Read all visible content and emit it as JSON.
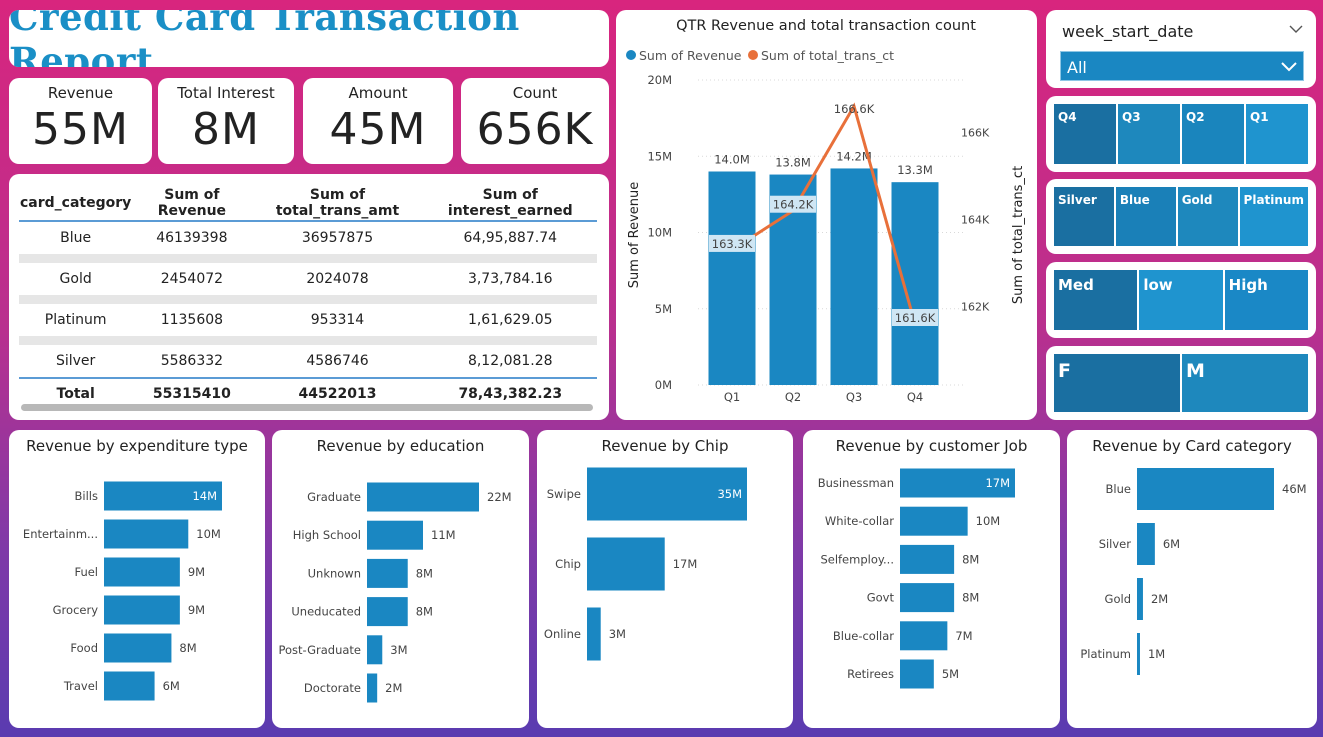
{
  "title": "Credit Card Transaction Report",
  "kpis": [
    {
      "label": "Revenue",
      "value": "55M"
    },
    {
      "label": "Total Interest",
      "value": "8M"
    },
    {
      "label": "Amount",
      "value": "45M"
    },
    {
      "label": "Count",
      "value": "656K"
    }
  ],
  "table": {
    "headers": [
      "card_category",
      "Sum of Revenue",
      "Sum of total_trans_amt",
      "Sum of interest_earned"
    ],
    "rows": [
      [
        "Blue",
        "46139398",
        "36957875",
        "64,95,887.74"
      ],
      [
        "Gold",
        "2454072",
        "2024078",
        "3,73,784.16"
      ],
      [
        "Platinum",
        "1135608",
        "953314",
        "1,61,629.05"
      ],
      [
        "Silver",
        "5586332",
        "4586746",
        "8,12,081.28"
      ]
    ],
    "total": [
      "Total",
      "55315410",
      "44522013",
      "78,43,382.23"
    ]
  },
  "slicers": {
    "date": {
      "label": "week_start_date",
      "value": "All"
    },
    "quarters": [
      "Q4",
      "Q3",
      "Q2",
      "Q1"
    ],
    "categories": [
      "Silver",
      "Blue",
      "Gold",
      "Platinum"
    ],
    "income": [
      "Med",
      "low",
      "High"
    ],
    "gender": [
      "F",
      "M"
    ]
  },
  "colors": {
    "bar": "#1a87c2",
    "line": "#e8703a",
    "title": "#1a8fc6"
  },
  "chart_data": [
    {
      "type": "bar",
      "title": "QTR Revenue and total transaction count",
      "categories": [
        "Q1",
        "Q2",
        "Q3",
        "Q4"
      ],
      "series": [
        {
          "name": "Sum of Revenue",
          "values": [
            14.0,
            13.8,
            14.2,
            13.3
          ],
          "labels": [
            "14.0M",
            "13.8M",
            "14.2M",
            "13.3M"
          ],
          "axis": "left"
        },
        {
          "name": "Sum of total_trans_ct",
          "type": "line",
          "values": [
            163.3,
            164.2,
            166.6,
            161.6
          ],
          "labels": [
            "163.3K",
            "164.2K",
            "166.6K",
            "161.6K"
          ],
          "axis": "right"
        }
      ],
      "ylabel": "Sum of Revenue",
      "y2label": "Sum of total_trans_ct",
      "ylim": [
        0,
        20
      ],
      "yticks": [
        "0M",
        "5M",
        "10M",
        "15M",
        "20M"
      ],
      "y2lim": [
        160.2,
        167.2
      ],
      "y2ticks": [
        "162K",
        "164K",
        "166K"
      ],
      "legend": "top-left"
    },
    {
      "type": "bar",
      "orientation": "horizontal",
      "title": "Revenue by expenditure type",
      "categories": [
        "Bills",
        "Entertainm...",
        "Fuel",
        "Grocery",
        "Food",
        "Travel"
      ],
      "values": [
        14,
        10,
        9,
        9,
        8,
        6
      ],
      "labels": [
        "14M",
        "10M",
        "9M",
        "9M",
        "8M",
        "6M"
      ]
    },
    {
      "type": "bar",
      "orientation": "horizontal",
      "title": "Revenue by education",
      "categories": [
        "Graduate",
        "High School",
        "Unknown",
        "Uneducated",
        "Post-Graduate",
        "Doctorate"
      ],
      "values": [
        22,
        11,
        8,
        8,
        3,
        2
      ],
      "labels": [
        "22M",
        "11M",
        "8M",
        "8M",
        "3M",
        "2M"
      ]
    },
    {
      "type": "bar",
      "orientation": "horizontal",
      "title": "Revenue by Chip",
      "categories": [
        "Swipe",
        "Chip",
        "Online"
      ],
      "values": [
        35,
        17,
        3
      ],
      "labels": [
        "35M",
        "17M",
        "3M"
      ]
    },
    {
      "type": "bar",
      "orientation": "horizontal",
      "title": "Revenue by customer Job",
      "categories": [
        "Businessman",
        "White-collar",
        "Selfemploy...",
        "Govt",
        "Blue-collar",
        "Retirees"
      ],
      "values": [
        17,
        10,
        8,
        8,
        7,
        5
      ],
      "labels": [
        "17M",
        "10M",
        "8M",
        "8M",
        "7M",
        "5M"
      ]
    },
    {
      "type": "bar",
      "orientation": "horizontal",
      "title": "Revenue by Card category",
      "categories": [
        "Blue",
        "Silver",
        "Gold",
        "Platinum"
      ],
      "values": [
        46,
        6,
        2,
        1
      ],
      "labels": [
        "46M",
        "6M",
        "2M",
        "1M"
      ]
    }
  ]
}
